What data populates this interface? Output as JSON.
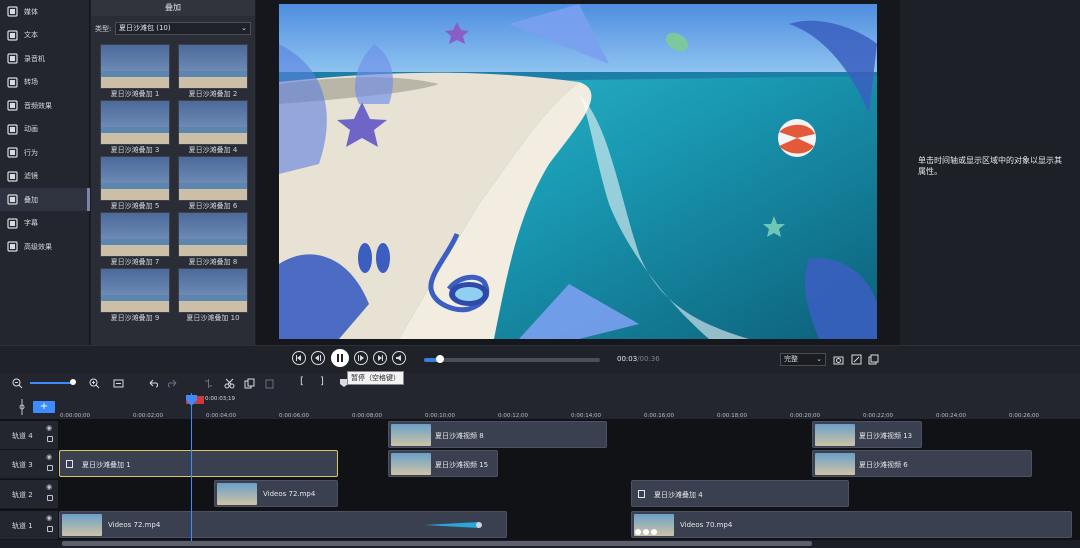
{
  "sidebar": {
    "items": [
      {
        "label": "媒体",
        "icon": "media-icon"
      },
      {
        "label": "文本",
        "icon": "text-icon"
      },
      {
        "label": "录音机",
        "icon": "microphone-icon"
      },
      {
        "label": "转场",
        "icon": "transition-icon"
      },
      {
        "label": "音频效果",
        "icon": "speaker-icon"
      },
      {
        "label": "动画",
        "icon": "arrow-icon"
      },
      {
        "label": "行为",
        "icon": "behavior-icon"
      },
      {
        "label": "滤镜",
        "icon": "wand-icon"
      },
      {
        "label": "叠加",
        "icon": "overlay-icon"
      },
      {
        "label": "字幕",
        "icon": "caption-icon"
      },
      {
        "label": "高级效果",
        "icon": "advanced-effects-icon"
      }
    ],
    "active_index": 8
  },
  "panel": {
    "title": "叠加",
    "type_label": "类型:",
    "type_value": "夏日沙滩包 (10)",
    "items": [
      "夏日沙滩叠加 1",
      "夏日沙滩叠加 2",
      "夏日沙滩叠加 3",
      "夏日沙滩叠加 4",
      "夏日沙滩叠加 5",
      "夏日沙滩叠加 6",
      "夏日沙滩叠加 7",
      "夏日沙滩叠加 8",
      "夏日沙滩叠加 9",
      "夏日沙滩叠加 10"
    ]
  },
  "properties": {
    "hint": "单击时间轴或显示区域中的对象以显示其属性。"
  },
  "transport": {
    "current_time": "00:03",
    "total_time": "/00:36",
    "progress": 0.09,
    "quality": "完整",
    "tooltip": "暂停（空格键）"
  },
  "timeline": {
    "playhead_time": "0:00:03;19",
    "ruler_labels": [
      "0:00:00;00",
      "0:00:02;00",
      "0:00:04;00",
      "0:00:06;00",
      "0:00:08;00",
      "0:00:10;00",
      "0:00:12;00",
      "0:00:14;00",
      "0:00:16;00",
      "0:00:18;00",
      "0:00:20;00",
      "0:00:22;00",
      "0:00:24;00",
      "0:00:26;00"
    ],
    "tracks": [
      {
        "name": "轨道 4"
      },
      {
        "name": "轨道 3"
      },
      {
        "name": "轨道 2"
      },
      {
        "name": "轨道 1"
      }
    ],
    "clips": {
      "t4a": "夏日沙滩视频 8",
      "t4b": "夏日沙滩视频 13",
      "t3a": "夏日沙滩叠加 1",
      "t3b": "夏日沙滩视频 15",
      "t3c": "夏日沙滩视频 6",
      "t2a": "Videos 72.mp4",
      "t2b": "夏日沙滩叠加 4",
      "t1a": "Videos 72.mp4",
      "t1b": "Videos 70.mp4"
    }
  },
  "colors": {
    "accent": "#3d8bff",
    "selected_clip_border": "#d7c85a"
  }
}
